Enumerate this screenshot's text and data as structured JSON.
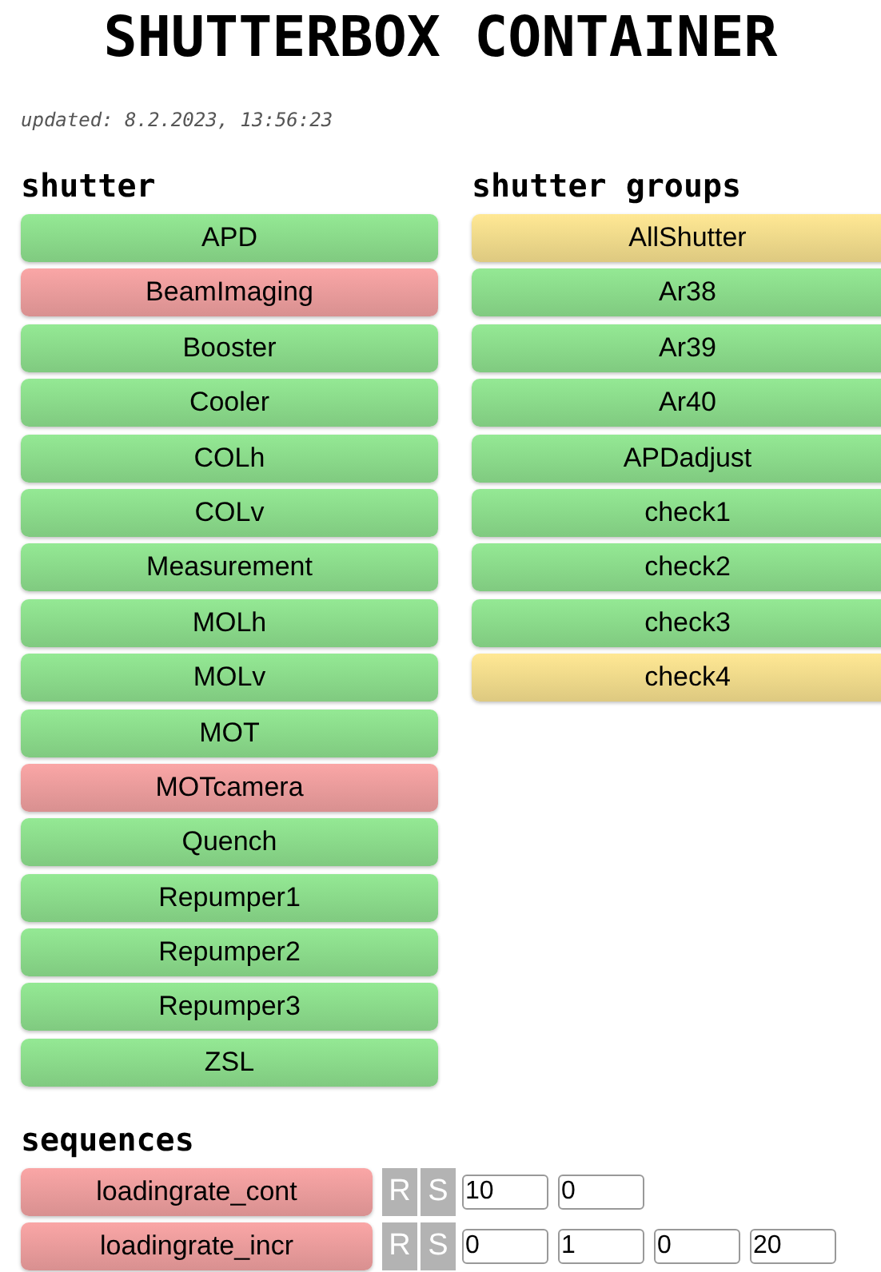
{
  "title": "SHUTTERBOX CONTAINER",
  "updated": "updated: 8.2.2023, 13:56:23",
  "shutter": {
    "heading": "shutter",
    "items": [
      {
        "label": "APD",
        "color": "#8ee08e"
      },
      {
        "label": "BeamImaging",
        "color": "#f0a0a0"
      },
      {
        "label": "Booster",
        "color": "#8ee08e"
      },
      {
        "label": "Cooler",
        "color": "#8ee08e"
      },
      {
        "label": "COLh",
        "color": "#8ee08e"
      },
      {
        "label": "COLv",
        "color": "#8ee08e"
      },
      {
        "label": "Measurement",
        "color": "#8ee08e"
      },
      {
        "label": "MOLh",
        "color": "#8ee08e"
      },
      {
        "label": "MOLv",
        "color": "#8ee08e"
      },
      {
        "label": "MOT",
        "color": "#8ee08e"
      },
      {
        "label": "MOTcamera",
        "color": "#f0a0a0"
      },
      {
        "label": "Quench",
        "color": "#8ee08e"
      },
      {
        "label": "Repumper1",
        "color": "#8ee08e"
      },
      {
        "label": "Repumper2",
        "color": "#8ee08e"
      },
      {
        "label": "Repumper3",
        "color": "#8ee08e"
      },
      {
        "label": "ZSL",
        "color": "#8ee08e"
      }
    ]
  },
  "shutter_groups": {
    "heading": "shutter groups",
    "items": [
      {
        "label": "AllShutter",
        "color": "#f5df8e"
      },
      {
        "label": "Ar38",
        "color": "#8ee08e"
      },
      {
        "label": "Ar39",
        "color": "#8ee08e"
      },
      {
        "label": "Ar40",
        "color": "#8ee08e"
      },
      {
        "label": "APDadjust",
        "color": "#8ee08e"
      },
      {
        "label": "check1",
        "color": "#8ee08e"
      },
      {
        "label": "check2",
        "color": "#8ee08e"
      },
      {
        "label": "check3",
        "color": "#8ee08e"
      },
      {
        "label": "check4",
        "color": "#f5df8e"
      }
    ]
  },
  "sequences": {
    "heading": "sequences",
    "items": [
      {
        "label": "loadingrate_cont",
        "color": "#f0a0a0",
        "actions": [
          "R",
          "S"
        ],
        "params": [
          "10",
          "0"
        ]
      },
      {
        "label": "loadingrate_incr",
        "color": "#f0a0a0",
        "actions": [
          "R",
          "S"
        ],
        "params": [
          "0",
          "1",
          "0",
          "20"
        ]
      }
    ]
  }
}
